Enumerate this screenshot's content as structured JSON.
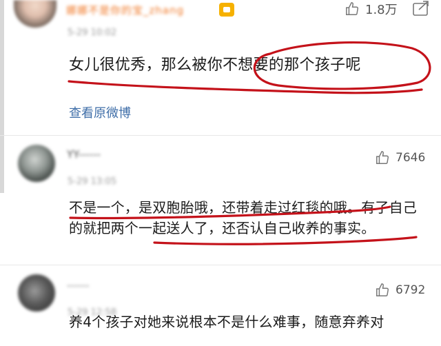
{
  "post": {
    "avatar_icon": "user-avatar",
    "username": "娜娜不是你的宝_zhang",
    "time": "5-29 10:02",
    "vip_icon": "vip-badge-icon",
    "like_count": "1.8万",
    "share_icon": "share-icon",
    "text": "女儿很优秀，那么被你不想要的那个孩子呢",
    "view_original_label": "查看原微博"
  },
  "comments": [
    {
      "username": "YY------",
      "time": "5-29 13:05",
      "like_count": "7646",
      "text": "不是一个，是双胞胎哦，还带着走过红毯的哦。有了自己的就把两个一起送人了，还否认自己收养的事实。"
    },
    {
      "username": "------",
      "time": "5-29 12:58",
      "like_count": "6792",
      "text": "养4个孩子对她来说根本不是什么难事，随意弃养对"
    }
  ],
  "colors": {
    "annotation_red": "#c4121a",
    "link_blue": "#3f6ea8"
  }
}
